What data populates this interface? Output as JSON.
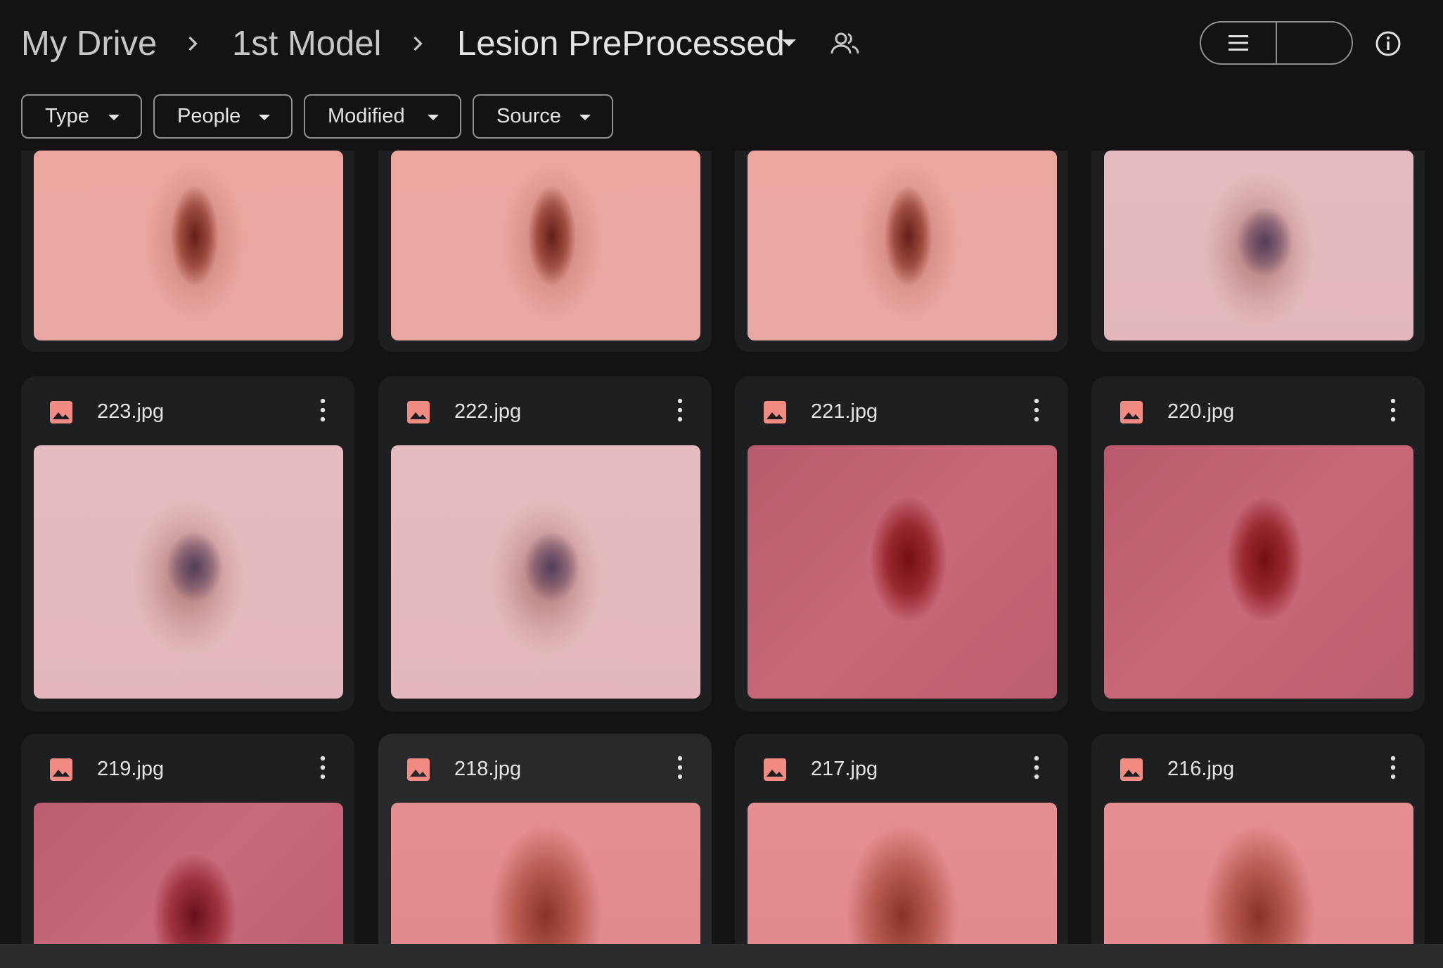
{
  "breadcrumb": {
    "items": [
      {
        "label": "My Drive"
      },
      {
        "label": "1st Model"
      },
      {
        "label": "Lesion PreProcessed"
      }
    ]
  },
  "toolbar": {
    "view_modes": [
      "list",
      "grid"
    ],
    "selected_view": "grid"
  },
  "filters": [
    {
      "label": "Type"
    },
    {
      "label": "People"
    },
    {
      "label": "Modified"
    },
    {
      "label": "Source"
    }
  ],
  "files": [
    {
      "name": "223.jpg"
    },
    {
      "name": "222.jpg"
    },
    {
      "name": "221.jpg"
    },
    {
      "name": "220.jpg"
    },
    {
      "name": "219.jpg"
    },
    {
      "name": "218.jpg"
    },
    {
      "name": "217.jpg"
    },
    {
      "name": "216.jpg"
    }
  ],
  "colors": {
    "background": "#131314",
    "card": "#1e1f20",
    "card_hover": "#28292b",
    "accent_selected": "#004a77",
    "image_icon": "#f28b82"
  }
}
